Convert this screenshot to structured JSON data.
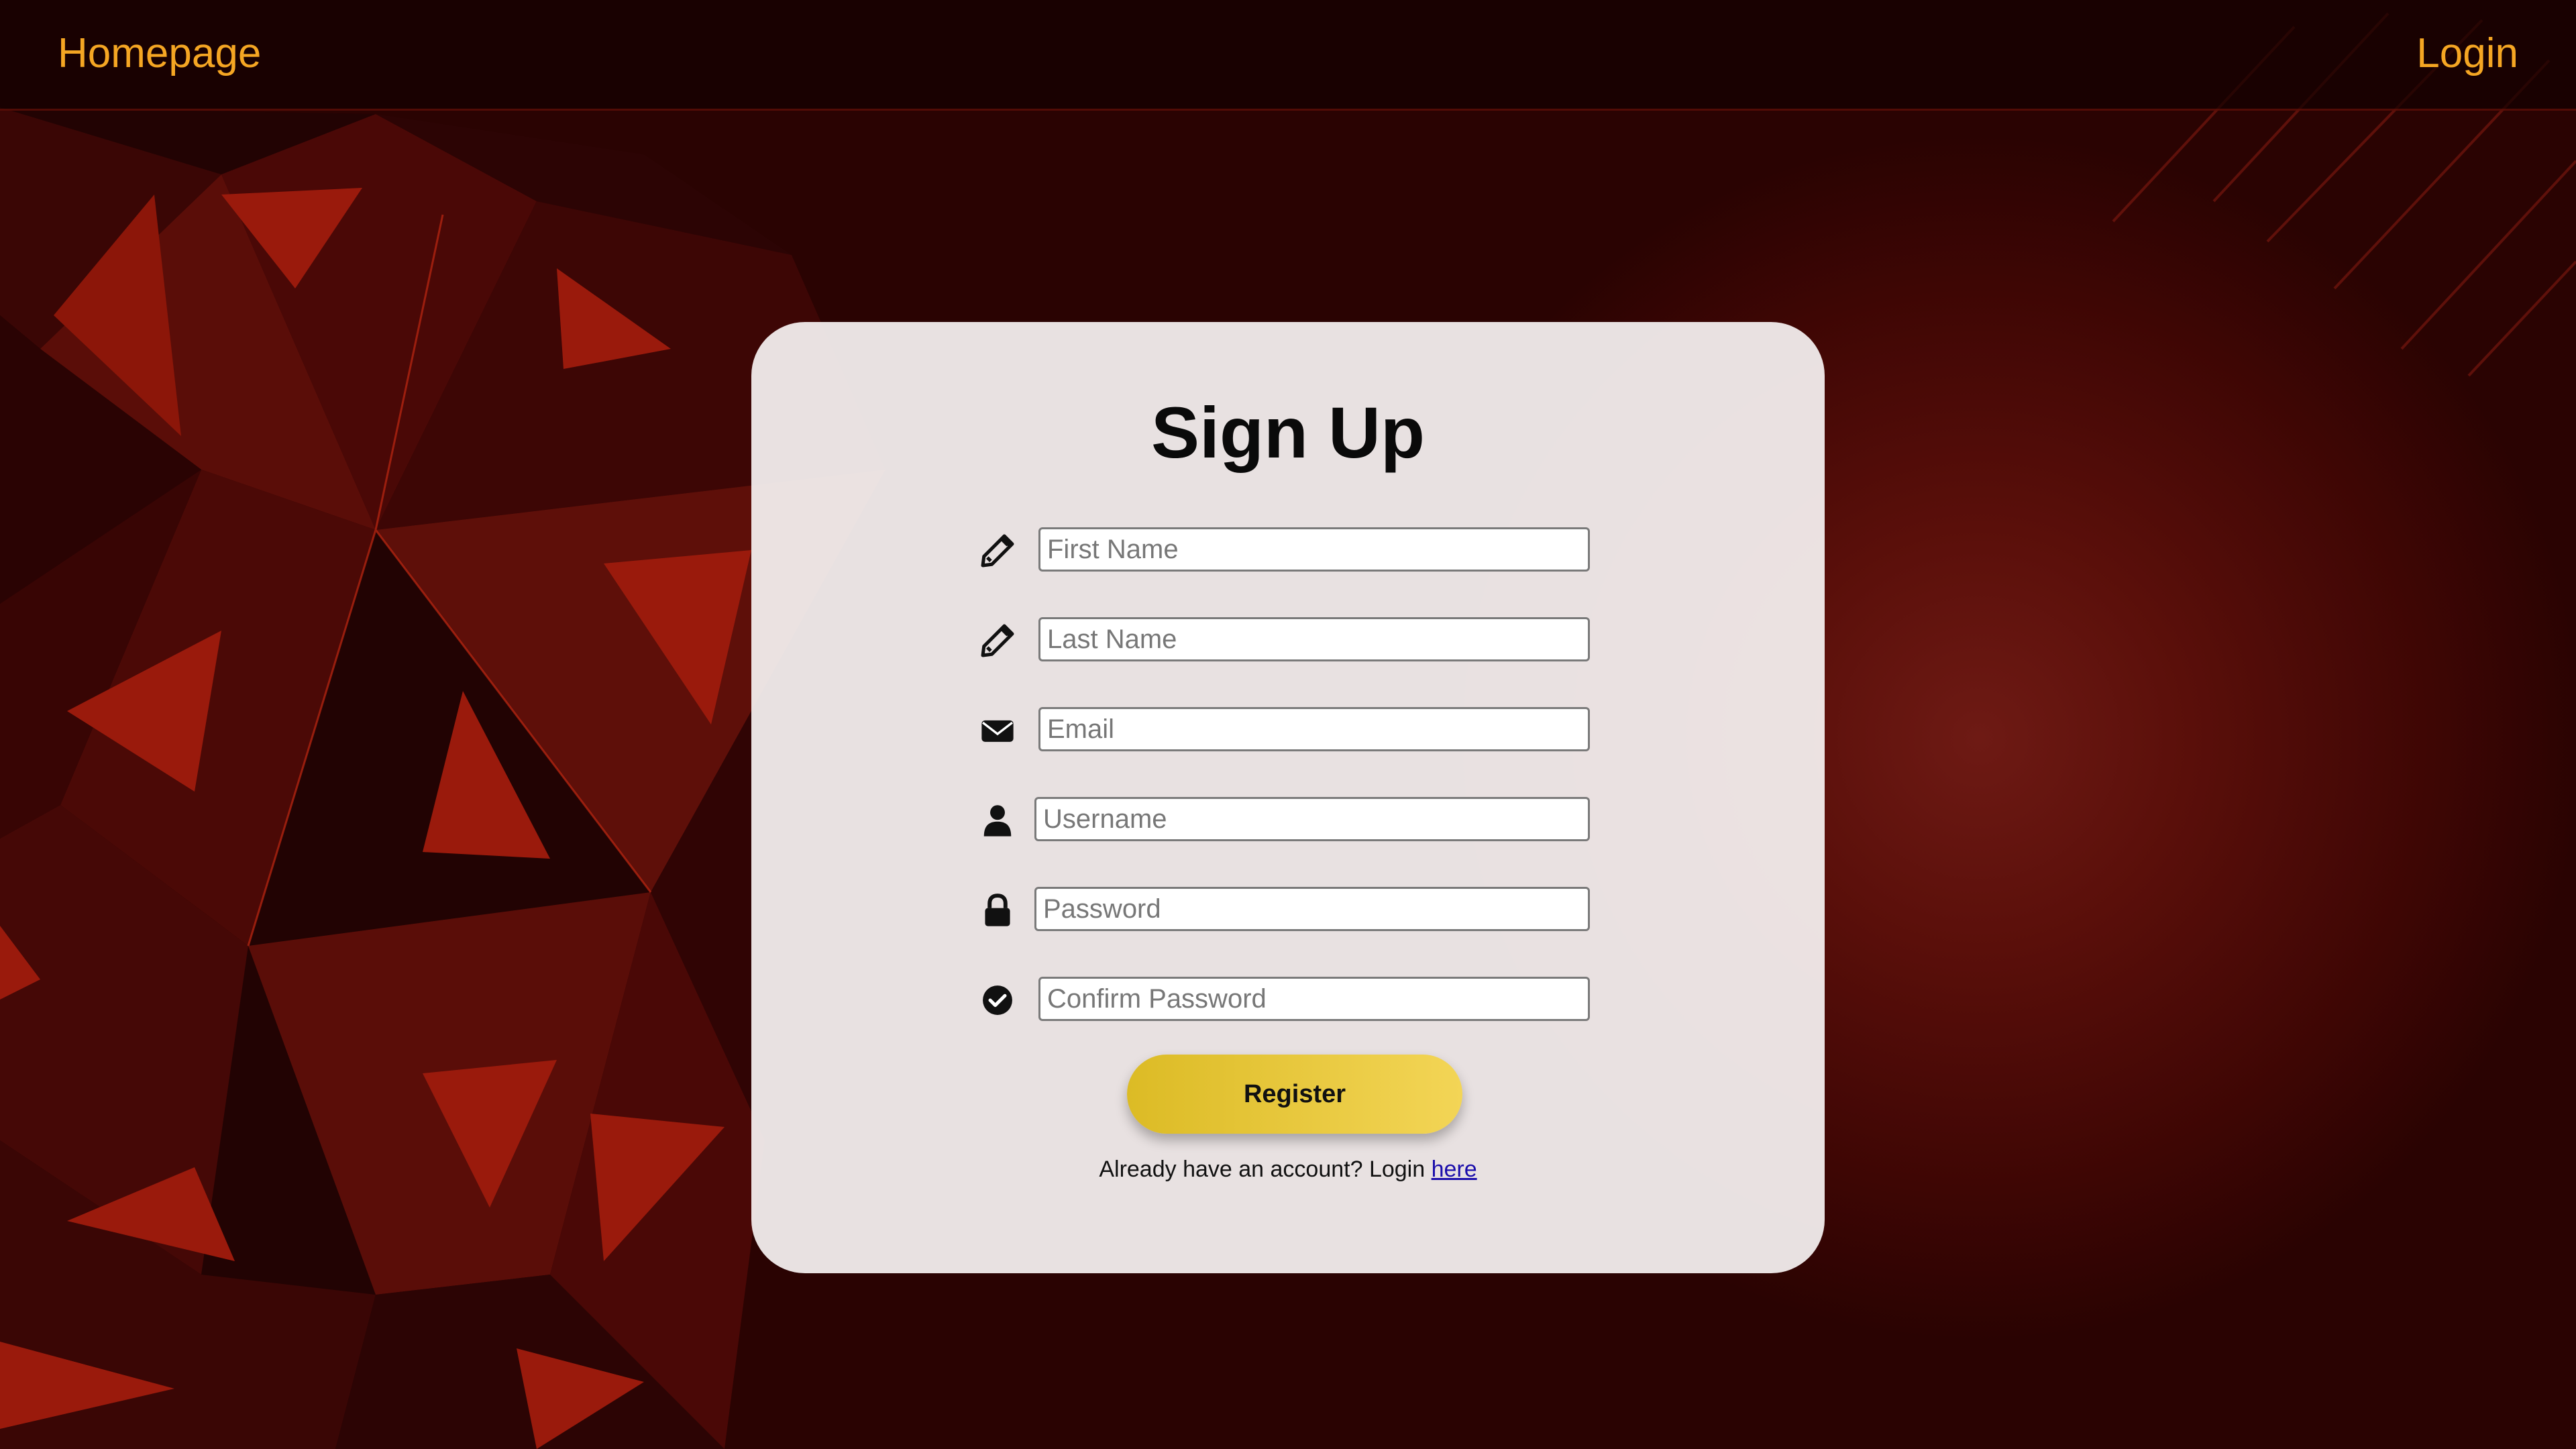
{
  "nav": {
    "home_label": "Homepage",
    "login_label": "Login",
    "link_color": "#f5a623"
  },
  "form": {
    "title": "Sign Up",
    "fields": [
      {
        "placeholder": "First Name",
        "icon": "pencil-icon"
      },
      {
        "placeholder": "Last Name",
        "icon": "pencil-icon"
      },
      {
        "placeholder": "Email",
        "icon": "envelope-icon"
      },
      {
        "placeholder": "Username",
        "icon": "user-icon"
      },
      {
        "placeholder": "Password",
        "icon": "lock-icon"
      },
      {
        "placeholder": "Confirm Password",
        "icon": "check-circle-icon"
      }
    ],
    "register_label": "Register",
    "login_prompt": "Already have an account? Login ",
    "login_link": "here",
    "button_color": "#e8c83a"
  }
}
